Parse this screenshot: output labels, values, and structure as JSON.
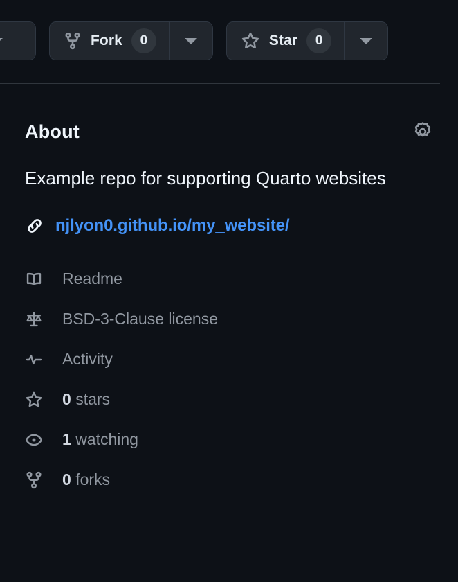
{
  "theme": {
    "background": "#0d1117",
    "button_bg": "#21262d",
    "button_border": "#2f3742",
    "badge_bg": "#30363d",
    "divider": "#30363d",
    "text_primary": "#f0f6fc",
    "text_muted": "#9198a1",
    "link_blue": "#4493f8"
  },
  "actions": {
    "watch": {
      "name": "watch-split-button",
      "caret_icon": "chevron-down-icon",
      "clipped": true
    },
    "fork": {
      "icon": "repo-forked-icon",
      "label": "Fork",
      "count": "0",
      "caret_icon": "chevron-down-icon"
    },
    "star": {
      "icon": "star-icon",
      "label": "Star",
      "count": "0",
      "caret_icon": "chevron-down-icon"
    }
  },
  "about": {
    "title": "About",
    "settings_icon": "gear-icon",
    "description": "Example repo for supporting Quarto websites",
    "homepage": {
      "icon": "link-icon",
      "url_text": "njlyon0.github.io/my_website/"
    },
    "meta": [
      {
        "icon": "book-icon",
        "name": "readme",
        "count": "",
        "label": "Readme"
      },
      {
        "icon": "law-icon",
        "name": "license",
        "count": "",
        "label": "BSD-3-Clause license"
      },
      {
        "icon": "pulse-icon",
        "name": "activity",
        "count": "",
        "label": "Activity"
      },
      {
        "icon": "star-icon",
        "name": "stars",
        "count": "0",
        "label": "stars"
      },
      {
        "icon": "eye-icon",
        "name": "watchers",
        "count": "1",
        "label": "watching"
      },
      {
        "icon": "fork-icon",
        "name": "forks",
        "count": "0",
        "label": "forks"
      }
    ]
  }
}
